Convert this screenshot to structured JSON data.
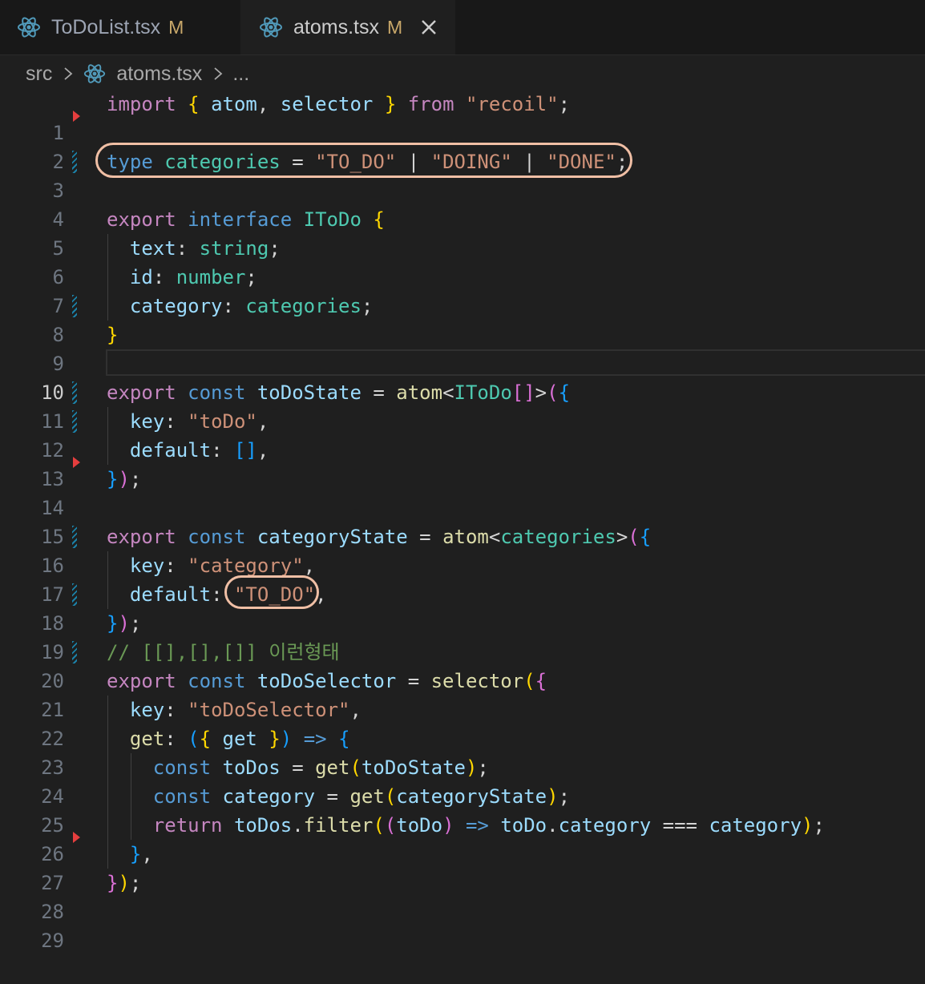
{
  "tabs": [
    {
      "label": "ToDoList.tsx",
      "modified": "M",
      "icon": "react-icon"
    },
    {
      "label": "atoms.tsx",
      "modified": "M",
      "icon": "react-icon",
      "active": true
    }
  ],
  "breadcrumb": {
    "folder": "src",
    "file": "atoms.tsx",
    "more": "..."
  },
  "editor": {
    "active_line": 10,
    "line_numbers": [
      "1",
      "2",
      "3",
      "4",
      "5",
      "6",
      "7",
      "8",
      "9",
      "10",
      "11",
      "12",
      "13",
      "14",
      "15",
      "16",
      "17",
      "18",
      "19",
      "20",
      "21",
      "22",
      "23",
      "24",
      "25",
      "26",
      "27",
      "28",
      "29"
    ],
    "code": {
      "l1": {
        "import": "import",
        "b1": "{",
        "atom": "atom",
        "comma": ",",
        "selector": "selector",
        "b2": "}",
        "from": "from",
        "mod": "\"recoil\"",
        "semi": ";"
      },
      "l3": {
        "type": "type",
        "name": "categories",
        "eq": "=",
        "s1": "\"TO_DO\"",
        "bar1": "|",
        "s2": "\"DOING\"",
        "bar2": "|",
        "s3": "\"DONE\"",
        "semi": ";"
      },
      "l5": {
        "export": "export",
        "interface": "interface",
        "name": "IToDo",
        "brace": "{"
      },
      "l6": {
        "prop": "text",
        "colon": ":",
        "type": "string",
        "semi": ";"
      },
      "l7": {
        "prop": "id",
        "colon": ":",
        "type": "number",
        "semi": ";"
      },
      "l8": {
        "prop": "category",
        "colon": ":",
        "type": "categories",
        "semi": ";"
      },
      "l9": {
        "brace": "}"
      },
      "l11": {
        "export": "export",
        "const": "const",
        "name": "toDoState",
        "eq": "=",
        "fn": "atom",
        "lt": "<",
        "type": "IToDo",
        "arr": "[]",
        "gt": ">",
        "paren": "(",
        "brace": "{"
      },
      "l12": {
        "prop": "key",
        "colon": ":",
        "val": "\"toDo\"",
        "comma": ","
      },
      "l13": {
        "prop": "default",
        "colon": ":",
        "val": "[]",
        "comma": ","
      },
      "l14": {
        "brace": "}",
        "paren": ")",
        "semi": ";"
      },
      "l16": {
        "export": "export",
        "const": "const",
        "name": "categoryState",
        "eq": "=",
        "fn": "atom",
        "lt": "<",
        "type": "categories",
        "gt": ">",
        "paren": "(",
        "brace": "{"
      },
      "l17": {
        "prop": "key",
        "colon": ":",
        "val": "\"category\"",
        "comma": ","
      },
      "l18": {
        "prop": "default",
        "colon": ":",
        "val": "\"TO_DO\"",
        "comma": ","
      },
      "l19": {
        "brace": "}",
        "paren": ")",
        "semi": ";"
      },
      "l20": {
        "comment": "// [[],[],[]] 이런형태"
      },
      "l21": {
        "export": "export",
        "const": "const",
        "name": "toDoSelector",
        "eq": "=",
        "fn": "selector",
        "paren": "(",
        "brace": "{"
      },
      "l22": {
        "prop": "key",
        "colon": ":",
        "val": "\"toDoSelector\"",
        "comma": ","
      },
      "l23": {
        "prop": "get",
        "colon": ":",
        "p1": "(",
        "b1": "{",
        "arg": "get",
        "b2": "}",
        "p2": ")",
        "arrow": "=>",
        "brace": "{"
      },
      "l24": {
        "const": "const",
        "name": "toDos",
        "eq": "=",
        "fn": "get",
        "p1": "(",
        "arg": "toDoState",
        "p2": ")",
        "semi": ";"
      },
      "l25": {
        "const": "const",
        "name": "category",
        "eq": "=",
        "fn": "get",
        "p1": "(",
        "arg": "categoryState",
        "p2": ")",
        "semi": ";"
      },
      "l26": {
        "return": "return",
        "obj": "toDos",
        "dot": ".",
        "fn": "filter",
        "p1": "(",
        "p2": "(",
        "arg": "toDo",
        "p3": ")",
        "arrow": "=>",
        "obj2": "toDo",
        "dot2": ".",
        "prop": "category",
        "op": "===",
        "cmp": "category",
        "p4": ")",
        "semi": ";"
      },
      "l27": {
        "brace": "}",
        "comma": ","
      },
      "l28": {
        "brace": "}",
        "paren": ")",
        "semi": ";"
      }
    }
  },
  "colors": {
    "keyword": "#c586c0",
    "storage": "#569cd6",
    "variable": "#9cdcfe",
    "type": "#4ec9b0",
    "string": "#ce9178",
    "function": "#dcdcaa",
    "comment": "#6a9955",
    "highlight": "#f0bfa5",
    "git_modified": "#1b81a8",
    "git_deleted": "#e53e3e"
  }
}
